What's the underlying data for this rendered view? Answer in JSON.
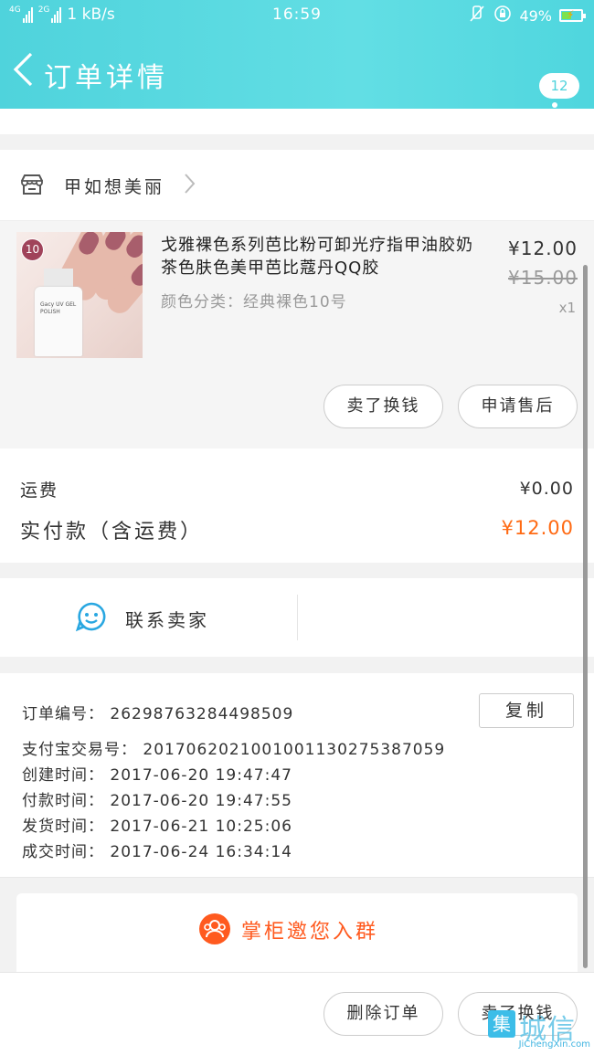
{
  "status_bar": {
    "network_1": "4G",
    "network_2": "2G",
    "speed": "1 kB/s",
    "time": "16:59",
    "battery_text": "49%",
    "battery_level": 0.49
  },
  "header": {
    "title": "订单详情",
    "message_count": "12"
  },
  "store": {
    "name": "甲如想美丽"
  },
  "product": {
    "title": "戈雅裸色系列芭比粉可卸光疗指甲油胶奶茶色肤色美甲芭比蔻丹QQ胶",
    "variant": "颜色分类：经典裸色10号",
    "price": "¥12.00",
    "original_price": "¥15.00",
    "quantity": "x1",
    "image_badge": "10",
    "bottle_text": "Gacy UV GEL POLISH",
    "buttons": {
      "sell": "卖了换钱",
      "after_sale": "申请售后"
    }
  },
  "fees": {
    "shipping_label": "运费",
    "shipping_value": "¥0.00",
    "total_label": "实付款（含运费）",
    "total_value": "¥12.00"
  },
  "contact": {
    "label": "联系卖家"
  },
  "order_info": {
    "order_no": "订单编号：  2629876328449850​9",
    "copy_label": "复制",
    "alipay_no": "支付宝交易号：  2017062021001001130275387059",
    "created": "创建时间：  2017-06-20 19:47:47",
    "paid": "付款时间：  2017-06-20 19:47:55",
    "shipped": "发货时间：  2017-06-21 10:25:06",
    "completed": "成交时间：  2017-06-24 16:34:14"
  },
  "invite": {
    "label": "掌柜邀您入群"
  },
  "bottom_bar": {
    "delete_label": "删除订单",
    "sell_label": "卖了换钱"
  },
  "watermark": {
    "text": "城信",
    "box_char": "集",
    "url": "JiChengXin.com"
  },
  "colors": {
    "header": "#4fd3dc",
    "accent_orange": "#ff6a13",
    "invite_orange": "#ff5a1f"
  }
}
